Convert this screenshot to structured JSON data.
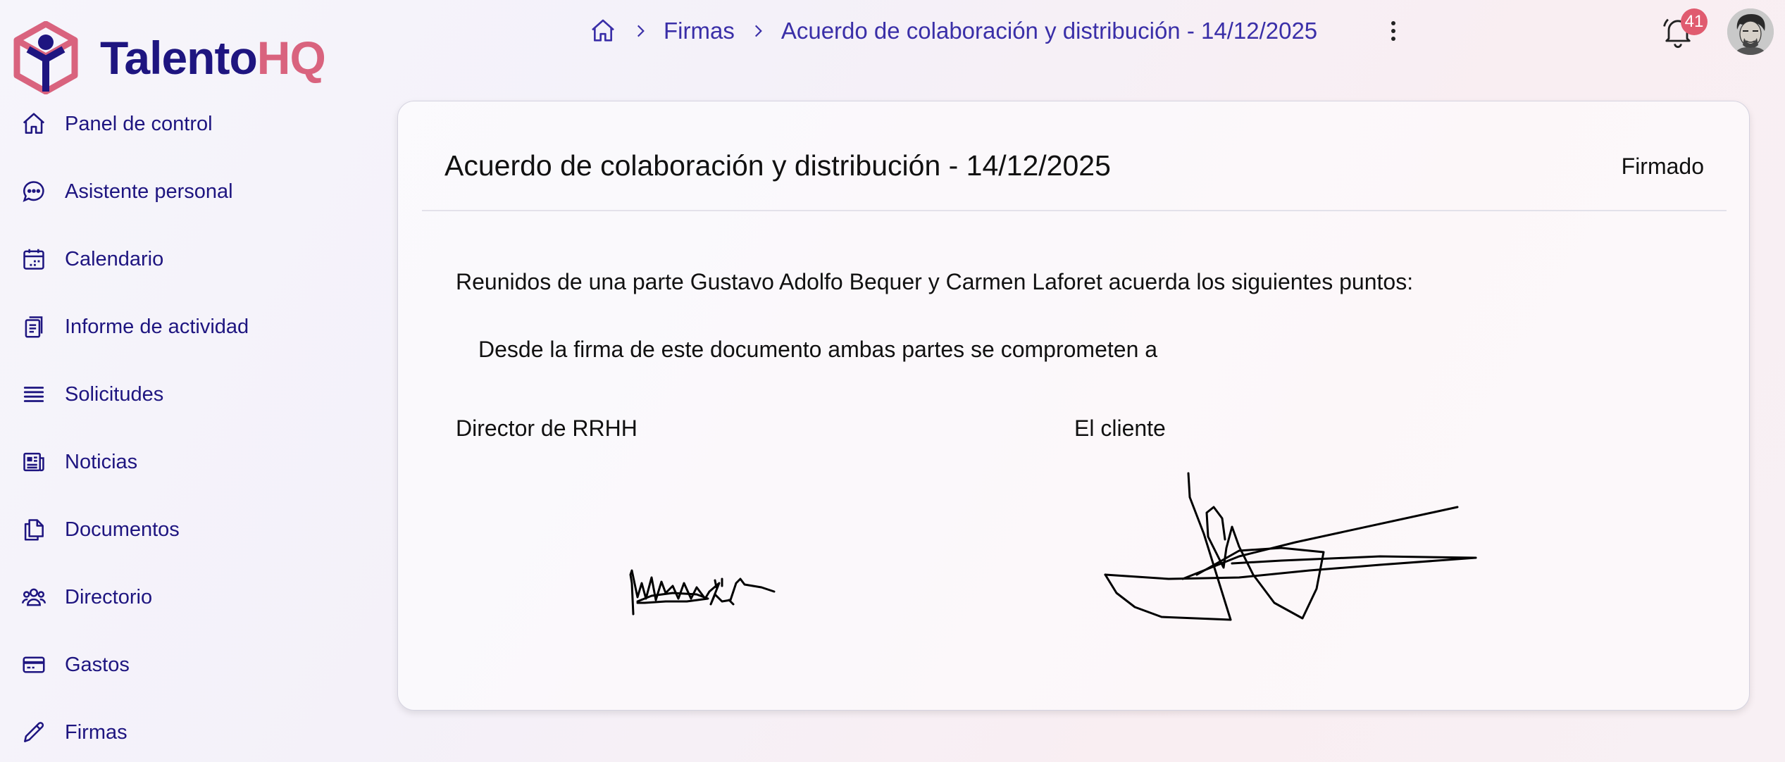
{
  "brand": {
    "name_part1": "Talento",
    "name_part2": "HQ",
    "colors": {
      "primary": "#1e1580",
      "accent": "#d9637e"
    }
  },
  "sidebar": {
    "items": [
      {
        "label": "Panel de control",
        "icon": "home-icon"
      },
      {
        "label": "Asistente personal",
        "icon": "chat-bubble-icon"
      },
      {
        "label": "Calendario",
        "icon": "calendar-icon"
      },
      {
        "label": "Informe de actividad",
        "icon": "clipboard-icon"
      },
      {
        "label": "Solicitudes",
        "icon": "list-icon"
      },
      {
        "label": "Noticias",
        "icon": "newspaper-icon"
      },
      {
        "label": "Documentos",
        "icon": "documents-icon"
      },
      {
        "label": "Directorio",
        "icon": "users-icon"
      },
      {
        "label": "Gastos",
        "icon": "credit-card-icon"
      },
      {
        "label": "Firmas",
        "icon": "pen-icon"
      }
    ]
  },
  "breadcrumb": {
    "home_icon": "home-icon",
    "items": [
      "Firmas",
      "Acuerdo de colaboración y distribución - 14/12/2025"
    ]
  },
  "header": {
    "notifications_count": "41",
    "menu_icon": "kebab-icon",
    "bell_icon": "bell-icon"
  },
  "document": {
    "title": "Acuerdo de colaboración y distribución - 14/12/2025",
    "status": "Firmado",
    "paragraph1": "Reunidos de una parte Gustavo Adolfo Bequer y Carmen Laforet acuerda los siguientes puntos:",
    "paragraph2": "Desde la firma de este documento ambas partes se comprometen a",
    "signatures": [
      {
        "label": "Director de RRHH"
      },
      {
        "label": "El cliente"
      }
    ]
  }
}
